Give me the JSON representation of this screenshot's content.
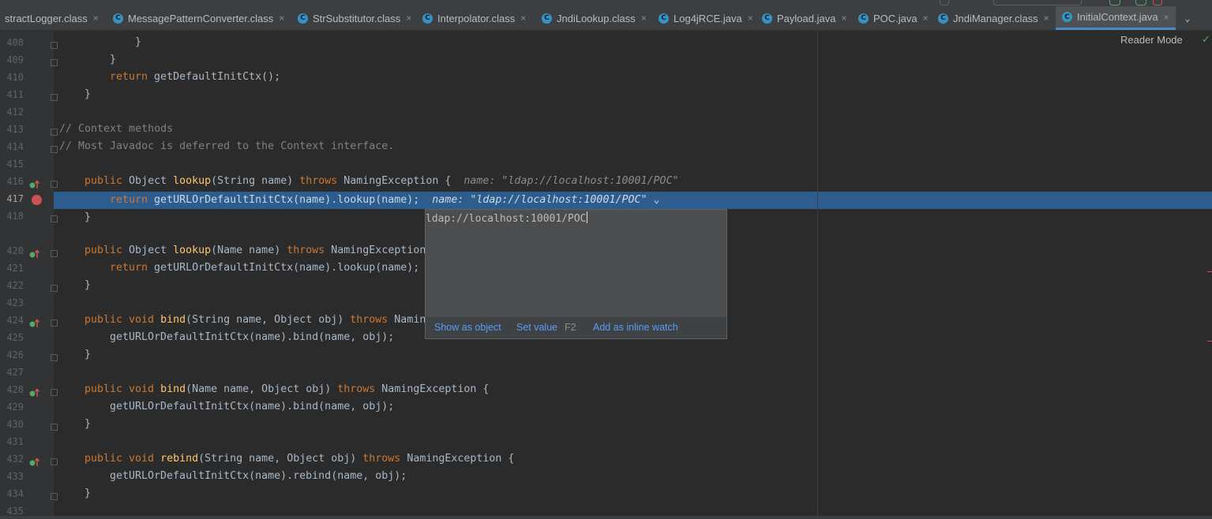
{
  "tabs": [
    {
      "label": "stractLogger.class",
      "icon": "class-icon",
      "active": false
    },
    {
      "label": "MessagePatternConverter.class",
      "icon": "class-icon",
      "active": false
    },
    {
      "label": "StrSubstitutor.class",
      "icon": "class-icon",
      "active": false
    },
    {
      "label": "Interpolator.class",
      "icon": "class-icon",
      "active": false
    },
    {
      "label": "JndiLookup.class",
      "icon": "class-icon",
      "active": false
    },
    {
      "label": "Log4jRCE.java",
      "icon": "java-class-icon",
      "active": false
    },
    {
      "label": "Payload.java",
      "icon": "java-class-icon",
      "active": false
    },
    {
      "label": "POC.java",
      "icon": "java-class-icon",
      "active": false
    },
    {
      "label": "JndiManager.class",
      "icon": "class-icon",
      "active": false
    },
    {
      "label": "InitialContext.java",
      "icon": "java-class-icon",
      "active": true
    }
  ],
  "tab_close_glyph": "×",
  "reader_mode": "Reader Mode",
  "line_numbers": [
    "408",
    "409",
    "410",
    "411",
    "412",
    "413",
    "414",
    "415",
    "416",
    "417",
    "418",
    "420",
    "421",
    "422",
    "423",
    "424",
    "425",
    "426",
    "427",
    "428",
    "429",
    "430",
    "431",
    "432",
    "433",
    "434",
    "435"
  ],
  "code": {
    "l408": "}",
    "l409": "}",
    "l410_kw": "return",
    "l410_rest": " getDefaultInitCtx();",
    "l411": "}",
    "l413": "// Context methods",
    "l414": "// Most Javadoc is deferred to the Context interface.",
    "l416_kw1": "public",
    "l416_t1": " Object ",
    "l416_fn": "lookup",
    "l416_t2": "(String name) ",
    "l416_kw2": "throws",
    "l416_t3": " NamingException {",
    "l416_hint": "name: \"ldap://localhost:10001/POC\"",
    "l417_kw": "return",
    "l417_rest": " getURLOrDefaultInitCtx(name).lookup(name);",
    "l417_hint": "name: \"ldap://localhost:10001/POC\"",
    "l418": "}",
    "l420_kw1": "public",
    "l420_t1": " Object ",
    "l420_fn": "lookup",
    "l420_t2": "(Name name) ",
    "l420_kw2": "throws",
    "l420_t3": " NamingException",
    "l421_kw": "return",
    "l421_rest": " getURLOrDefaultInitCtx(name).lookup(name);",
    "l422": "}",
    "l424_kw1": "public void",
    "l424_t1": " ",
    "l424_fn": "bind",
    "l424_t2": "(String name, Object obj) ",
    "l424_kw2": "throws",
    "l424_t3": " Namin",
    "l425": "getURLOrDefaultInitCtx(name).bind(name, obj);",
    "l426": "}",
    "l428_kw1": "public void",
    "l428_t1": " ",
    "l428_fn": "bind",
    "l428_t2": "(Name name, Object obj) ",
    "l428_kw2": "throws",
    "l428_t3": " NamingException {",
    "l429": "getURLOrDefaultInitCtx(name).bind(name, obj);",
    "l430": "}",
    "l432_kw1": "public void",
    "l432_t1": " ",
    "l432_fn": "rebind",
    "l432_t2": "(String name, Object obj) ",
    "l432_kw2": "throws",
    "l432_t3": " NamingException {",
    "l433": "getURLOrDefaultInitCtx(name).rebind(name, obj);",
    "l434": "}"
  },
  "popup": {
    "value": "ldap://localhost:10001/POC",
    "show_as_object": "Show as object",
    "set_value": "Set value",
    "set_value_key": "F2",
    "add_inline_watch": "Add as inline watch"
  },
  "colors": {
    "keyword": "#cc7832",
    "function": "#ffc66d",
    "comment": "#808080",
    "selection": "#2d5c8f",
    "link": "#589df6",
    "breakpoint": "#c75450"
  }
}
